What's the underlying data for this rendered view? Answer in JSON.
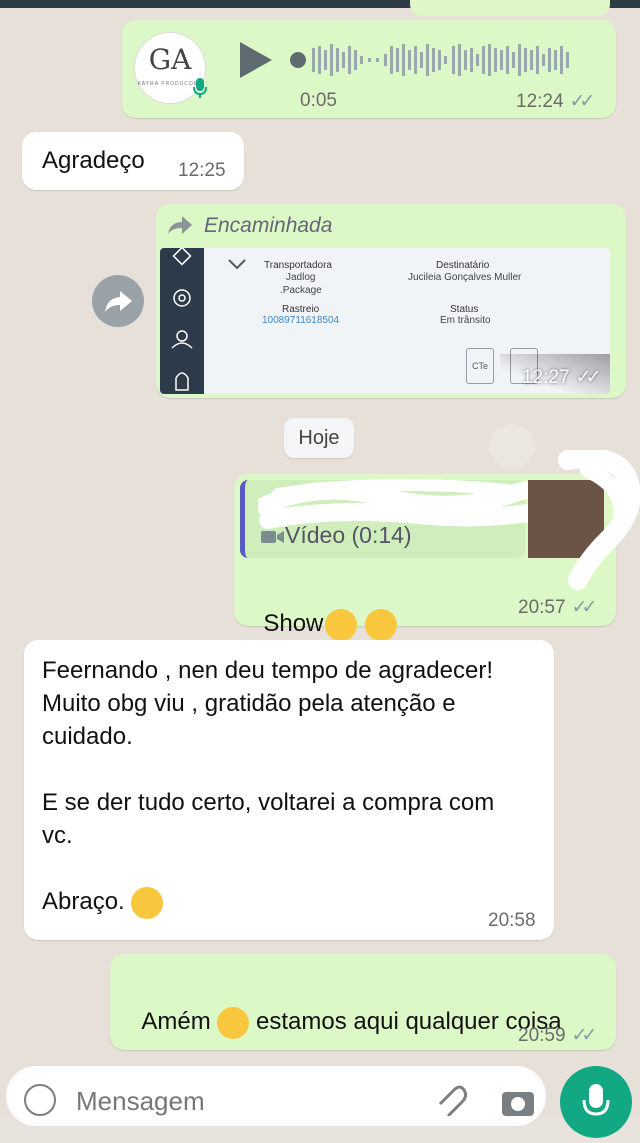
{
  "audio_message": {
    "duration": "0:05",
    "time": "12:24",
    "avatar_initials": "GA",
    "avatar_caption": "KAYRA PRODUCOES"
  },
  "received_1": {
    "text": "Agradeço",
    "time": "12:25"
  },
  "forwarded": {
    "label": "Encaminhada",
    "time": "12:27",
    "doc": {
      "carrier_label": "Transportadora",
      "carrier_value": "Jadlog",
      "carrier_sub": ".Package",
      "recipient_label": "Destinatário",
      "recipient_value": "Jucileia Gonçalves Muller",
      "tracking_label": "Rastreio",
      "tracking_value": "10089711618504",
      "status_label": "Status",
      "status_value": "Em trânsito",
      "file_label": "CTe"
    }
  },
  "date_divider": "Hoje",
  "reply_message": {
    "quoted_kind": "Vídeo (0:14)",
    "text": "Show",
    "time": "20:57"
  },
  "received_2": {
    "text_lines": [
      "Feernando , nen deu tempo de agradecer!",
      "Muito obg viu , gratidão pela atenção e",
      "cuidado.",
      "",
      "E se der tudo certo, voltarei a compra com",
      "vc.",
      "",
      "Abraço."
    ],
    "time": "20:58"
  },
  "sent_last": {
    "text_before": "Amém",
    "text_after": "estamos aqui qualquer coisa",
    "time": "20:59"
  },
  "compose": {
    "placeholder": "Mensagem"
  },
  "colors": {
    "outgoing": "#dcf8c6",
    "incoming": "#ffffff",
    "accent": "#12a884",
    "quote_bar": "#5a5ac6"
  }
}
